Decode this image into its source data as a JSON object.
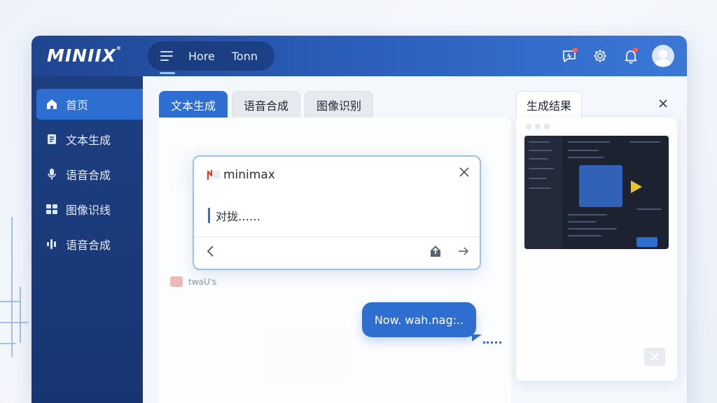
{
  "app": {
    "logo": "MINIIX",
    "logo_mark": "®"
  },
  "topbar": {
    "nav_links": [
      "Hore",
      "Tonn"
    ],
    "icons": [
      "chat-alert-icon",
      "gear-icon",
      "bell-icon",
      "user-avatar"
    ]
  },
  "sidebar": {
    "items": [
      {
        "label": "首页",
        "icon": "home-icon",
        "active": true
      },
      {
        "label": "文本生成",
        "icon": "document-icon",
        "active": false
      },
      {
        "label": "语音合成",
        "icon": "microphone-icon",
        "active": false
      },
      {
        "label": "图像识线",
        "icon": "image-grid-icon",
        "active": false
      },
      {
        "label": "语音合成",
        "icon": "waveform-icon",
        "active": false
      }
    ]
  },
  "tabs": [
    {
      "label": "文本生成",
      "active": true
    },
    {
      "label": "语音合成",
      "active": false
    },
    {
      "label": "图像识别",
      "active": false
    }
  ],
  "dialog": {
    "brand": "minimax",
    "input_text": "对拢……",
    "buttons": [
      "back-arrow-icon",
      "upload-icon",
      "send-arrow-icon"
    ]
  },
  "chat": {
    "note": "twaU's",
    "bubble": "Now. wah.nag:.."
  },
  "result": {
    "tab_label": "生成结果"
  },
  "colors": {
    "accent": "#2f6ed1",
    "sidebar": "#1d3f82",
    "topbar": "#2a5cb8",
    "notification": "#ff5a4e"
  }
}
